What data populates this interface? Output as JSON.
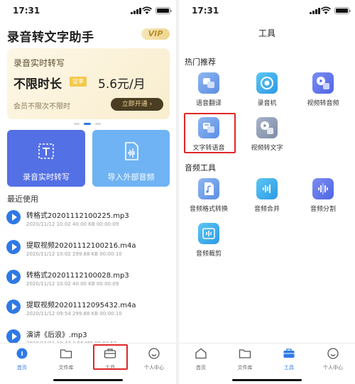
{
  "left": {
    "status_time": "17:31",
    "app_title": "录音转文字助手",
    "vip_label": "VIP",
    "promo": {
      "line1": "录音实时转写",
      "line2": "不限时长",
      "badge": "证享",
      "price": "5.6元/月",
      "line3": "会员不限次不限时",
      "button": "立即开通"
    },
    "cards": [
      {
        "label": "录音实时转写",
        "icon": "transcribe-frame-icon"
      },
      {
        "label": "导入外部音频",
        "icon": "import-audio-icon"
      }
    ],
    "recent_title": "最近使用",
    "recent": [
      {
        "name": "转格式20201112100225.mp3",
        "meta": "2020/11/12 10:02  40.00 KB  00:00:09"
      },
      {
        "name": "提取视频20201112100216.m4a",
        "meta": "2020/11/12 10:02  299.88 KB  00:00:10"
      },
      {
        "name": "转格式20201112100028.mp3",
        "meta": "2020/11/12 10:02  40.00 KB  00:00:09"
      },
      {
        "name": "提取视频20201112095432.m4a",
        "meta": "2020/11/12 09:54  299.88 KB  00:00:10"
      },
      {
        "name": "演讲《后浪》.mp3",
        "meta": "2020/11/11 10:47  3.56 MB  00:03:53"
      }
    ],
    "tabs": [
      "首页",
      "文件库",
      "工具",
      "个人中心"
    ]
  },
  "right": {
    "status_time": "17:31",
    "page_title": "工具",
    "section1": "热门推荐",
    "hot_tools": [
      "语音翻译",
      "录音机",
      "视频转音频",
      "文字转语音",
      "视频转文字"
    ],
    "section2": "音频工具",
    "audio_tools": [
      "音频格式转换",
      "音频合并",
      "音频分割",
      "音频裁剪"
    ],
    "tabs": [
      "首页",
      "文件库",
      "工具",
      "个人中心"
    ]
  },
  "colors": {
    "accent": "#2f79e6",
    "highlight_box": "#e02727",
    "card1": "#5470e5",
    "card2": "#6fb3f4"
  }
}
